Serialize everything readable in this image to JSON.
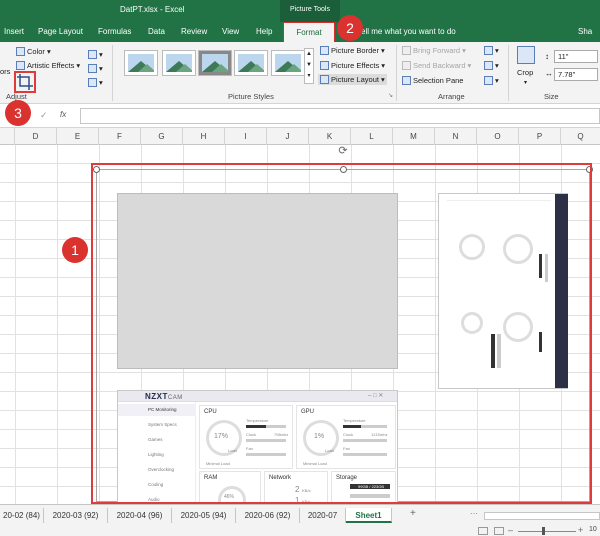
{
  "titlebar": {
    "filename": "DatPT.xlsx - Excel",
    "context_label": "Picture Tools"
  },
  "tabs": [
    {
      "label": "Insert"
    },
    {
      "label": "Page Layout"
    },
    {
      "label": "Formulas"
    },
    {
      "label": "Data"
    },
    {
      "label": "Review"
    },
    {
      "label": "View"
    },
    {
      "label": "Help"
    },
    {
      "label": "Format"
    },
    {
      "label": "ell me what you want to do"
    },
    {
      "label": "Sha"
    }
  ],
  "ribbon": {
    "adjust": {
      "color": "Color",
      "artistic_effects": "Artistic Effects",
      "fragment": "ors",
      "label": "Adjust"
    },
    "picture_styles": {
      "label": "Picture Styles",
      "border": "Picture Border",
      "effects": "Picture Effects",
      "layout": "Picture Layout"
    },
    "arrange": {
      "bring_forward": "Bring Forward",
      "send_backward": "Send Backward",
      "selection_pane": "Selection Pane",
      "label": "Arrange"
    },
    "size": {
      "crop": "Crop",
      "height": "11\"",
      "width": "7.78\"",
      "label": "Size"
    }
  },
  "formula_bar": {
    "fx": "fx",
    "check": "✓"
  },
  "columns": [
    "D",
    "E",
    "F",
    "G",
    "H",
    "I",
    "J",
    "K",
    "L",
    "M",
    "N",
    "O",
    "P",
    "Q"
  ],
  "callouts": {
    "one": "1",
    "two": "2",
    "three": "3"
  },
  "app_preview": {
    "logo": "NZXT",
    "logo_suffix": "CAM",
    "nav": [
      "PC Monitoring",
      "System Specs",
      "Games",
      "Lighting",
      "Overclocking",
      "Cooling",
      "Audio"
    ],
    "cpu": {
      "title": "CPU",
      "value": "17%",
      "temp_label": "Temperature",
      "clock_label": "Clock",
      "fan_label": "Fan",
      "clock_val": "798mhz",
      "load_label": "Load",
      "minload_label": "Minimal Load"
    },
    "gpu": {
      "title": "GPU",
      "value": "1%",
      "temp_label": "Temperature",
      "clock_label": "Clock",
      "fan_label": "Fan",
      "clock_val": "1215mhz",
      "load_label": "Load",
      "minload_label": "Minimal Load"
    },
    "ram": {
      "title": "RAM",
      "value": "46%"
    },
    "network": {
      "title": "Network",
      "up": "2",
      "up_unit": "KB/s",
      "down": "1",
      "down_unit": "KB/s"
    },
    "storage": {
      "title": "Storage",
      "bar_text": "99GB / 223GB"
    }
  },
  "sheets": {
    "tabs": [
      "20-02 (84)",
      "2020-03 (92)",
      "2020-04 (96)",
      "2020-05 (94)",
      "2020-06 (92)",
      "2020-07"
    ],
    "active": "Sheet1",
    "add": "+",
    "more": "⋯"
  },
  "status": {
    "zoom": "10"
  }
}
